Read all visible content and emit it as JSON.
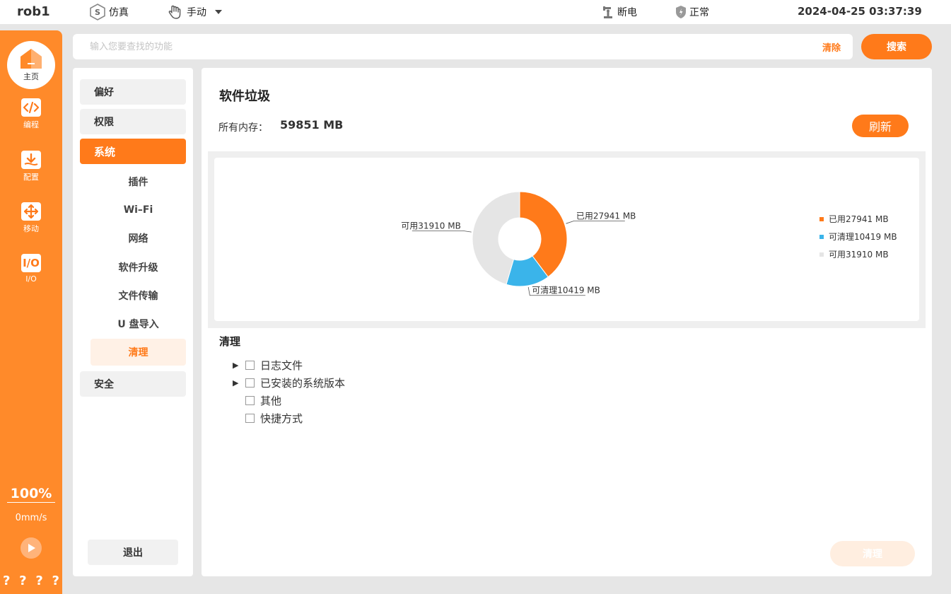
{
  "topbar": {
    "robot_name": "rob1",
    "mode_sim": "仿真",
    "mode_manual": "手动",
    "power_status": "断电",
    "safety_status": "正常",
    "datetime": "2024-04-25 03:37:39"
  },
  "sidebar": {
    "items": [
      {
        "label": "主页",
        "icon": "home-icon"
      },
      {
        "label": "编程",
        "icon": "code-icon"
      },
      {
        "label": "配置",
        "icon": "download-config-icon"
      },
      {
        "label": "移动",
        "icon": "move-arrows-icon"
      },
      {
        "label": "I/O",
        "icon": "io-icon"
      }
    ],
    "speed_percent": "100%",
    "speed_value": "0mm/s",
    "bottom_marks": [
      "?",
      "?",
      "?",
      "?"
    ]
  },
  "search": {
    "placeholder": "输入您要查找的功能",
    "clear_label": "清除",
    "button_label": "搜索"
  },
  "menu": {
    "categories": {
      "preferences": "偏好",
      "permissions": "权限",
      "system": "系统",
      "security": "安全"
    },
    "system_items": [
      "插件",
      "Wi–Fi",
      "网络",
      "软件升级",
      "文件传输",
      "U 盘导入",
      "清理"
    ],
    "active_item": "清理",
    "logout_label": "退出"
  },
  "main": {
    "title": "软件垃圾",
    "memory_label": "所有内存：",
    "memory_value": "59851 MB",
    "refresh_label": "刷新",
    "clean_section_title": "清理",
    "tree": [
      {
        "label": "日志文件",
        "expandable": true
      },
      {
        "label": "已安装的系统版本",
        "expandable": true
      },
      {
        "label": "其他",
        "expandable": false
      },
      {
        "label": "快捷方式",
        "expandable": false
      }
    ],
    "clean_button_label": "清理"
  },
  "colors": {
    "accent": "#ff7a1a",
    "cleanable": "#3ab4ea",
    "available": "#e5e5e5"
  },
  "chart_data": {
    "type": "pie",
    "donut": true,
    "categories": [
      "已用",
      "可清理",
      "可用"
    ],
    "values": [
      27941,
      10419,
      31910
    ],
    "unit": "MB",
    "labels": [
      "已用27941 MB",
      "可清理10419 MB",
      "可用31910 MB"
    ],
    "colors": [
      "#ff7a1a",
      "#3ab4ea",
      "#e5e5e5"
    ],
    "legend_position": "right"
  }
}
